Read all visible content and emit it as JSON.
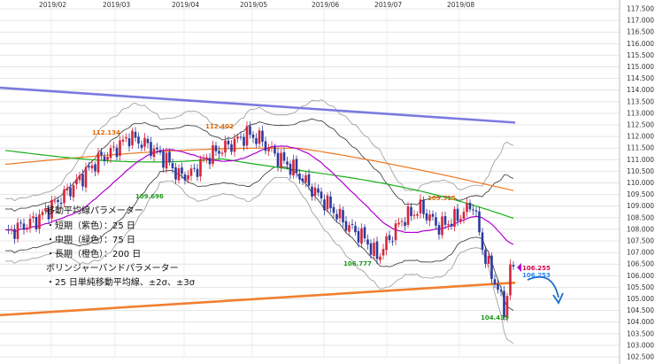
{
  "chart_data": {
    "type": "candlestick",
    "title": "",
    "x_tick_labels": [
      "2019/02",
      "2019/03",
      "2019/04",
      "2019/05",
      "2019/06",
      "2019/07",
      "2019/08"
    ],
    "y_tick_labels": [
      "117.500",
      "117.000",
      "116.500",
      "116.000",
      "115.500",
      "115.000",
      "114.500",
      "114.000",
      "113.500",
      "113.000",
      "112.500",
      "112.000",
      "111.500",
      "111.000",
      "110.500",
      "110.000",
      "109.500",
      "109.000",
      "108.500",
      "108.000",
      "107.500",
      "107.000",
      "106.500",
      "106.000",
      "105.500",
      "105.000",
      "104.500",
      "104.000",
      "103.500",
      "103.000",
      "102.500"
    ],
    "ylim": [
      102.5,
      117.5
    ],
    "grid": true,
    "legend_lines": [
      "移動平均線パラメーター",
      "・短期（紫色）：25 日",
      "・中期（緑色）：75 日",
      "・長期（橙色）：200 日",
      "ボリンジャーバンドパラメーター",
      "・25 日単純移動平均線、±2σ、±3σ"
    ],
    "annotations": [
      {
        "text": "112.134",
        "value": 112.134,
        "color": "#e06a00"
      },
      {
        "text": "112.402",
        "value": 112.402,
        "color": "#e06a00"
      },
      {
        "text": "109.696",
        "value": 109.696,
        "color": "#1a9a1a"
      },
      {
        "text": "109.315",
        "value": 109.315,
        "color": "#e06a00"
      },
      {
        "text": "106.777",
        "value": 106.777,
        "color": "#1a9a1a"
      },
      {
        "text": "104.439",
        "value": 104.439,
        "color": "#1a9a1a"
      },
      {
        "text": "106.255",
        "value": 106.255,
        "color": "#d6004a"
      },
      {
        "text": "106.253",
        "value": 106.253,
        "color": "#2288ff"
      }
    ],
    "colors": {
      "up": "#d6243a",
      "down": "#2a3a9e",
      "sma25": "#b000d0",
      "sma75": "#18b018",
      "sma200": "#f07820",
      "bands": "#999999",
      "bands2": "#333333",
      "trend_upper": "#7a7ae0",
      "trend_lower": "#f08030",
      "arrow": "#1a6ad0"
    },
    "trendlines": [
      {
        "name": "upper",
        "from": {
          "x": "2019/01/15",
          "y": 114.1
        },
        "to": {
          "x": "2019/08/28",
          "y": 112.6
        }
      },
      {
        "name": "lower",
        "from": {
          "x": "2019/01/15",
          "y": 104.3
        },
        "to": {
          "x": "2019/08/28",
          "y": 105.7
        }
      }
    ]
  }
}
